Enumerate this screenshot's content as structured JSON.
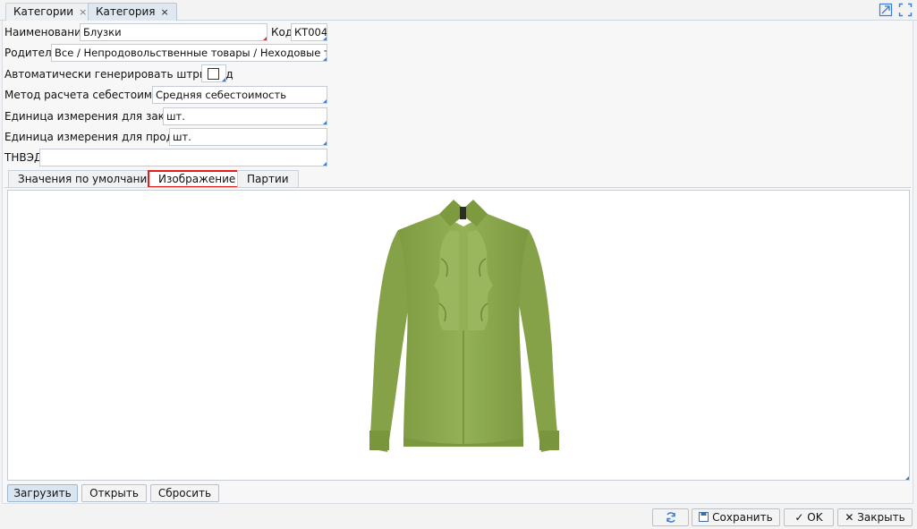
{
  "tabs": [
    {
      "label": "Категории",
      "close": "×"
    },
    {
      "label": "Категория",
      "close": "×"
    }
  ],
  "window_icons": [
    "restore-icon",
    "fullscreen-icon"
  ],
  "form": {
    "name_label": "Наименование",
    "name_value": "Блузки",
    "code_label": "Код",
    "code_value": "КТ004",
    "parent_label": "Родитель",
    "parent_value": "Все / Непродовольственные товары / Неходовые товары",
    "barcode_label": "Автоматически генерировать штрихкод",
    "cost_label": "Метод расчета себестоимости",
    "cost_value": "Средняя себестоимость",
    "buy_unit_label": "Единица измерения для закупки",
    "buy_unit_value": "шт.",
    "sell_unit_label": "Единица измерения для продажи",
    "sell_unit_value": "шт.",
    "tnved_label": "ТНВЭД",
    "tnved_value": ""
  },
  "inner_tabs": [
    "Значения по умолчанию",
    "Изображение",
    "Партии"
  ],
  "image_buttons": {
    "upload": "Загрузить",
    "open": "Открыть",
    "reset": "Сбросить"
  },
  "footer": {
    "refresh_icon": "refresh-icon",
    "save": "Сохранить",
    "ok": "OK",
    "close": "Закрыть"
  },
  "colors": {
    "accent_blue": "#3a7bd5",
    "required_red": "#d9342b",
    "active_tab_border": "#e01e1e",
    "blouse_green": "#8aa64c"
  }
}
